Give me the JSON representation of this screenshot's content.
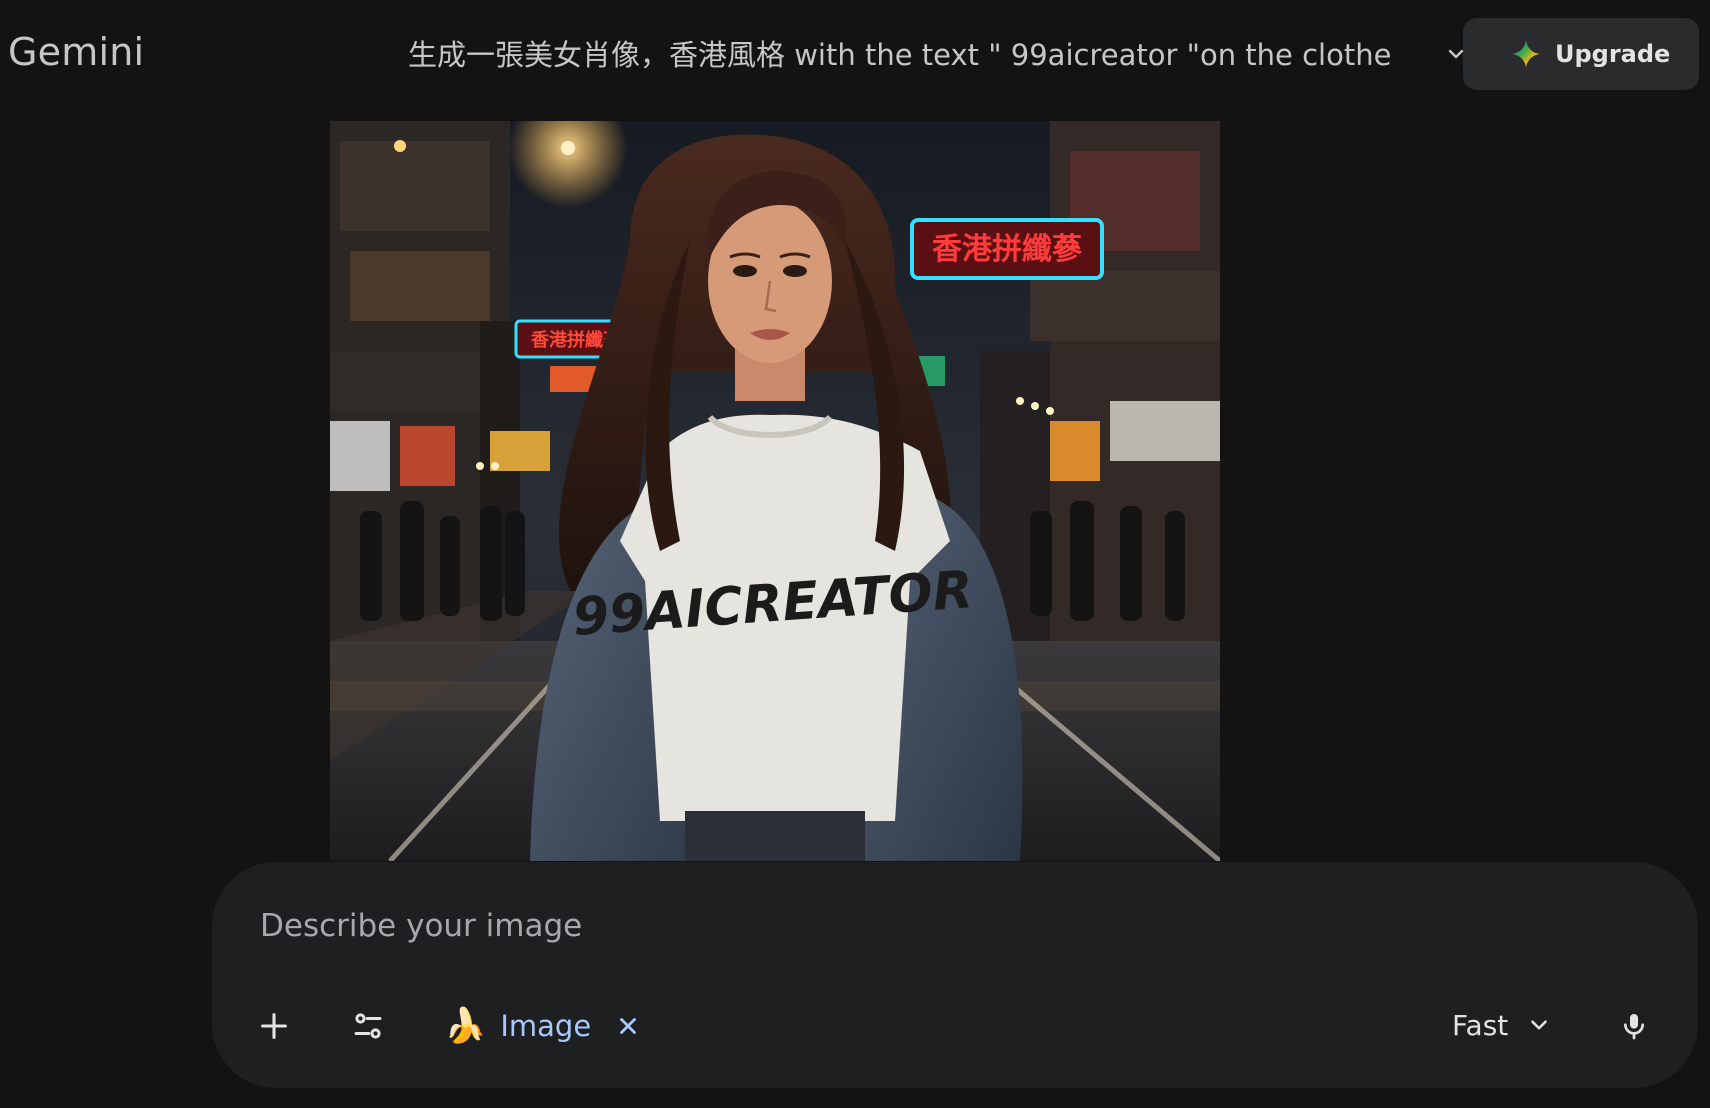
{
  "app": {
    "brand": "Gemini",
    "conversation_title": "生成一張美女肖像，香港風格 with the text \" 99aicreator \"on the clothe",
    "upgrade_label": "Upgrade"
  },
  "generated_image": {
    "shirt_text": "99AICREATOR",
    "neon_sign_1": "香港拼纖蔘",
    "neon_sign_2": "香港拼纖蔘"
  },
  "composer": {
    "placeholder": "Describe your image",
    "value": "",
    "tool_chip_label": "Image",
    "tool_chip_emoji": "🍌",
    "model_label": "Fast"
  },
  "icons": {
    "title_dropdown": "chevron-down-icon",
    "upgrade": "gemini-sparkle-icon",
    "add": "plus-icon",
    "tools": "tune-icon",
    "chip_close": "close-icon",
    "model_dropdown": "chevron-down-icon",
    "mic": "microphone-icon"
  },
  "colors": {
    "background": "#131314",
    "composer_bg": "#1e1f20",
    "upgrade_bg": "#2a2b2d",
    "chip_accent": "#a8c7fa",
    "neon_cyan": "#33e0ff",
    "neon_red": "#ff3b3b"
  }
}
